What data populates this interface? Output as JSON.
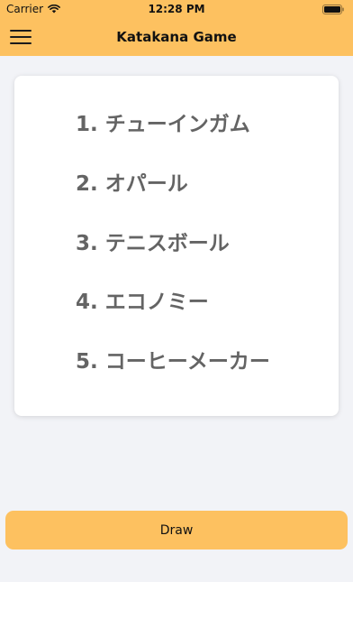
{
  "status_bar": {
    "carrier": "Carrier",
    "time": "12:28 PM",
    "wifi_icon": "wifi-icon",
    "battery_icon": "battery-icon"
  },
  "nav": {
    "title": "Katakana Game",
    "menu_icon": "hamburger-menu-icon"
  },
  "words": [
    "1. チューインガム",
    "2. オパール",
    "3. テニスボール",
    "4. エコノミー",
    "5. コーヒーメーカー"
  ],
  "draw_button": {
    "label": "Draw"
  },
  "colors": {
    "accent": "#fdc160",
    "background": "#f2f3f7",
    "word_text": "#646464"
  }
}
